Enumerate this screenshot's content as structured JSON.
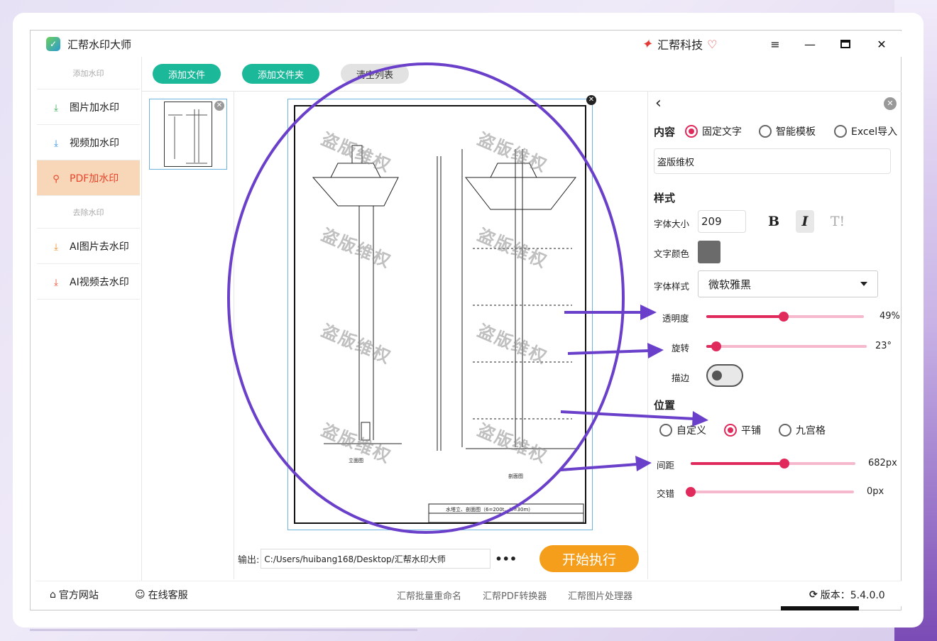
{
  "window": {
    "title": "汇帮水印大师",
    "brand": "汇帮科技",
    "logo_icon": "app-logo-icon"
  },
  "sidebar": {
    "section_add": "添加水印",
    "section_remove": "去除水印",
    "items": [
      {
        "label": "图片加水印",
        "icon": "download-icon",
        "color": "#2eaa4f",
        "active": false
      },
      {
        "label": "视频加水印",
        "icon": "download-icon",
        "color": "#2a8de0",
        "active": false
      },
      {
        "label": "PDF加水印",
        "icon": "pdf-icon",
        "color": "#e8452b",
        "active": true
      },
      {
        "label": "AI图片去水印",
        "icon": "download-icon",
        "color": "#f08a24",
        "active": false
      },
      {
        "label": "AI视频去水印",
        "icon": "download-icon",
        "color": "#e8452b",
        "active": false
      }
    ]
  },
  "toolbar": {
    "add_file": "添加文件",
    "add_folder": "添加文件夹",
    "clear_list": "清空列表"
  },
  "preview": {
    "watermark_text": "盗版维权",
    "drawing_title": "水塔立、剖面图（6=200t、H=30m）",
    "section_label_left": "立面图",
    "section_label_right": "剖面图"
  },
  "output": {
    "label": "输出:",
    "path": "C:/Users/huibang168/Desktop/汇帮水印大师",
    "more": "•••",
    "start": "开始执行"
  },
  "panel": {
    "content_heading": "内容",
    "content_options": [
      {
        "label": "固定文字",
        "selected": true
      },
      {
        "label": "智能模板",
        "selected": false
      },
      {
        "label": "Excel导入",
        "selected": false
      }
    ],
    "text_value": "盗版维权",
    "style_heading": "样式",
    "font_size_label": "字体大小",
    "font_size": "209",
    "bold": "B",
    "italic": "I",
    "strike": "T!",
    "text_color_label": "文字颜色",
    "text_color": "#6b6b6b",
    "font_style_label": "字体样式",
    "font_family": "微软雅黑",
    "opacity_label": "透明度",
    "opacity_value": "49%",
    "opacity": 0.49,
    "rotate_label": "旋转",
    "rotate_value": "23°",
    "rotate": 0.064,
    "stroke_label": "描边",
    "stroke_on": false,
    "position_heading": "位置",
    "position_options": [
      {
        "label": "自定义",
        "selected": false
      },
      {
        "label": "平铺",
        "selected": true
      },
      {
        "label": "九宫格",
        "selected": false
      }
    ],
    "spacing_label": "间距",
    "spacing_value": "682px",
    "spacing": 0.57,
    "stagger_label": "交错",
    "stagger_value": "0px",
    "stagger": 0.0,
    "accent_color": "#e02a5b"
  },
  "footer": {
    "website": "官方网站",
    "support": "在线客服",
    "link1": "汇帮批量重命名",
    "link2": "汇帮PDF转换器",
    "link3": "汇帮图片处理器",
    "version": "版本：5.4.0.0"
  }
}
